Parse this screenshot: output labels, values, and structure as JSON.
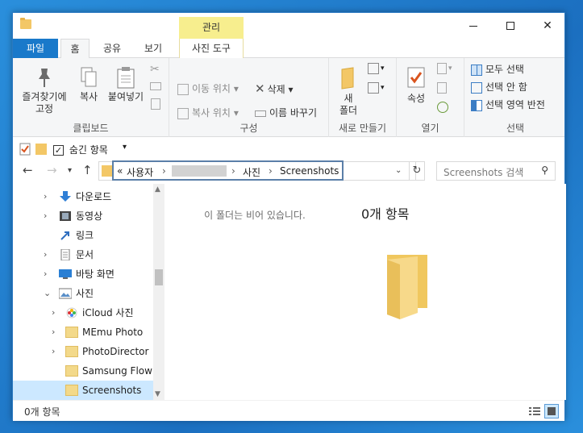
{
  "window": {
    "context_tab_header": "관리",
    "controls": {
      "minimize": "",
      "maximize": "",
      "close": "✕"
    }
  },
  "tabs": {
    "file": "파일",
    "home": "홈",
    "share": "공유",
    "view": "보기",
    "photo_tools": "사진 도구"
  },
  "ribbon": {
    "clipboard": {
      "pin": "즐겨찾기에\n고정",
      "copy": "복사",
      "paste": "붙여넣기",
      "label": "클립보드"
    },
    "organize": {
      "move_to": "이동 위치",
      "copy_to": "복사 위치",
      "delete": "삭제",
      "rename": "이름 바꾸기",
      "label": "구성"
    },
    "new": {
      "new_folder": "새\n폴더",
      "label": "새로 만들기"
    },
    "open": {
      "properties": "속성",
      "label": "열기"
    },
    "select": {
      "select_all": "모두 선택",
      "select_none": "선택 안 함",
      "invert": "선택 영역 반전",
      "label": "선택"
    }
  },
  "quick_access": {
    "hidden_items_label": "숨긴 항목",
    "hidden_items_checked": true
  },
  "address": {
    "prefix": "«",
    "segment1": "사용자",
    "segment3": "사진",
    "segment4": "Screenshots",
    "search_placeholder": "Screenshots 검색"
  },
  "nav_tree": [
    {
      "label": "다운로드",
      "icon": "download-icon"
    },
    {
      "label": "동영상",
      "icon": "video-icon"
    },
    {
      "label": "링크",
      "icon": "link-icon"
    },
    {
      "label": "문서",
      "icon": "document-icon"
    },
    {
      "label": "바탕 화면",
      "icon": "desktop-icon"
    },
    {
      "label": "사진",
      "icon": "pictures-icon"
    },
    {
      "label": "iCloud 사진",
      "icon": "icloud-photos-icon"
    },
    {
      "label": "MEmu Photo",
      "icon": "folder-icon"
    },
    {
      "label": "PhotoDirector",
      "icon": "folder-icon"
    },
    {
      "label": "Samsung Flow",
      "icon": "folder-icon"
    },
    {
      "label": "Screenshots",
      "icon": "folder-icon"
    }
  ],
  "content": {
    "empty_message": "이 폴더는 비어 있습니다."
  },
  "preview": {
    "item_count": "0개 항목"
  },
  "status": {
    "item_count": "0개 항목"
  },
  "colors": {
    "accent": "#1979ca",
    "context_tab": "#f7ee8e",
    "selected": "#cce8ff",
    "folder": "#f3c766"
  }
}
